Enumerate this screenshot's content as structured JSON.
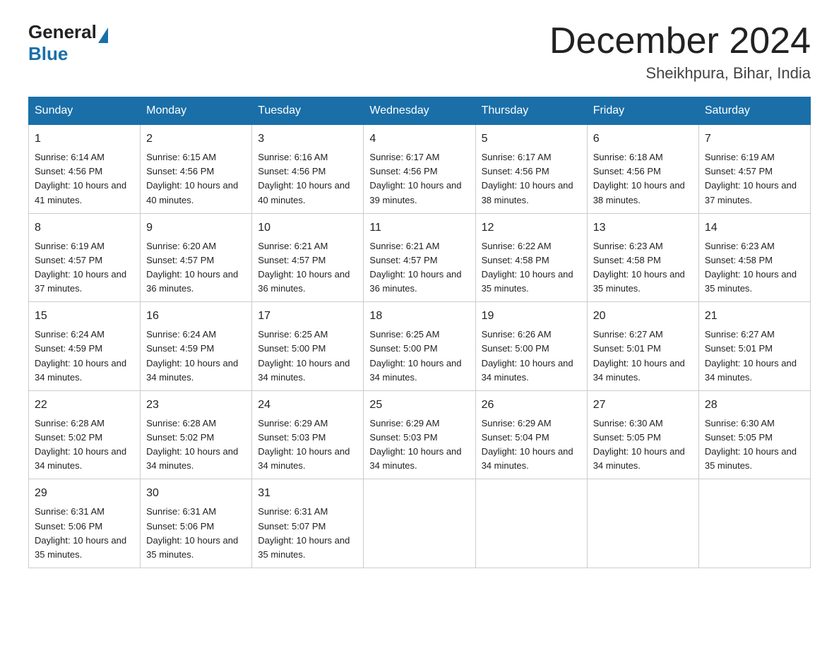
{
  "header": {
    "logo_general": "General",
    "logo_blue": "Blue",
    "month_title": "December 2024",
    "location": "Sheikhpura, Bihar, India"
  },
  "days_of_week": [
    "Sunday",
    "Monday",
    "Tuesday",
    "Wednesday",
    "Thursday",
    "Friday",
    "Saturday"
  ],
  "weeks": [
    [
      {
        "day": "1",
        "sunrise": "6:14 AM",
        "sunset": "4:56 PM",
        "daylight": "10 hours and 41 minutes."
      },
      {
        "day": "2",
        "sunrise": "6:15 AM",
        "sunset": "4:56 PM",
        "daylight": "10 hours and 40 minutes."
      },
      {
        "day": "3",
        "sunrise": "6:16 AM",
        "sunset": "4:56 PM",
        "daylight": "10 hours and 40 minutes."
      },
      {
        "day": "4",
        "sunrise": "6:17 AM",
        "sunset": "4:56 PM",
        "daylight": "10 hours and 39 minutes."
      },
      {
        "day": "5",
        "sunrise": "6:17 AM",
        "sunset": "4:56 PM",
        "daylight": "10 hours and 38 minutes."
      },
      {
        "day": "6",
        "sunrise": "6:18 AM",
        "sunset": "4:56 PM",
        "daylight": "10 hours and 38 minutes."
      },
      {
        "day": "7",
        "sunrise": "6:19 AM",
        "sunset": "4:57 PM",
        "daylight": "10 hours and 37 minutes."
      }
    ],
    [
      {
        "day": "8",
        "sunrise": "6:19 AM",
        "sunset": "4:57 PM",
        "daylight": "10 hours and 37 minutes."
      },
      {
        "day": "9",
        "sunrise": "6:20 AM",
        "sunset": "4:57 PM",
        "daylight": "10 hours and 36 minutes."
      },
      {
        "day": "10",
        "sunrise": "6:21 AM",
        "sunset": "4:57 PM",
        "daylight": "10 hours and 36 minutes."
      },
      {
        "day": "11",
        "sunrise": "6:21 AM",
        "sunset": "4:57 PM",
        "daylight": "10 hours and 36 minutes."
      },
      {
        "day": "12",
        "sunrise": "6:22 AM",
        "sunset": "4:58 PM",
        "daylight": "10 hours and 35 minutes."
      },
      {
        "day": "13",
        "sunrise": "6:23 AM",
        "sunset": "4:58 PM",
        "daylight": "10 hours and 35 minutes."
      },
      {
        "day": "14",
        "sunrise": "6:23 AM",
        "sunset": "4:58 PM",
        "daylight": "10 hours and 35 minutes."
      }
    ],
    [
      {
        "day": "15",
        "sunrise": "6:24 AM",
        "sunset": "4:59 PM",
        "daylight": "10 hours and 34 minutes."
      },
      {
        "day": "16",
        "sunrise": "6:24 AM",
        "sunset": "4:59 PM",
        "daylight": "10 hours and 34 minutes."
      },
      {
        "day": "17",
        "sunrise": "6:25 AM",
        "sunset": "5:00 PM",
        "daylight": "10 hours and 34 minutes."
      },
      {
        "day": "18",
        "sunrise": "6:25 AM",
        "sunset": "5:00 PM",
        "daylight": "10 hours and 34 minutes."
      },
      {
        "day": "19",
        "sunrise": "6:26 AM",
        "sunset": "5:00 PM",
        "daylight": "10 hours and 34 minutes."
      },
      {
        "day": "20",
        "sunrise": "6:27 AM",
        "sunset": "5:01 PM",
        "daylight": "10 hours and 34 minutes."
      },
      {
        "day": "21",
        "sunrise": "6:27 AM",
        "sunset": "5:01 PM",
        "daylight": "10 hours and 34 minutes."
      }
    ],
    [
      {
        "day": "22",
        "sunrise": "6:28 AM",
        "sunset": "5:02 PM",
        "daylight": "10 hours and 34 minutes."
      },
      {
        "day": "23",
        "sunrise": "6:28 AM",
        "sunset": "5:02 PM",
        "daylight": "10 hours and 34 minutes."
      },
      {
        "day": "24",
        "sunrise": "6:29 AM",
        "sunset": "5:03 PM",
        "daylight": "10 hours and 34 minutes."
      },
      {
        "day": "25",
        "sunrise": "6:29 AM",
        "sunset": "5:03 PM",
        "daylight": "10 hours and 34 minutes."
      },
      {
        "day": "26",
        "sunrise": "6:29 AM",
        "sunset": "5:04 PM",
        "daylight": "10 hours and 34 minutes."
      },
      {
        "day": "27",
        "sunrise": "6:30 AM",
        "sunset": "5:05 PM",
        "daylight": "10 hours and 34 minutes."
      },
      {
        "day": "28",
        "sunrise": "6:30 AM",
        "sunset": "5:05 PM",
        "daylight": "10 hours and 35 minutes."
      }
    ],
    [
      {
        "day": "29",
        "sunrise": "6:31 AM",
        "sunset": "5:06 PM",
        "daylight": "10 hours and 35 minutes."
      },
      {
        "day": "30",
        "sunrise": "6:31 AM",
        "sunset": "5:06 PM",
        "daylight": "10 hours and 35 minutes."
      },
      {
        "day": "31",
        "sunrise": "6:31 AM",
        "sunset": "5:07 PM",
        "daylight": "10 hours and 35 minutes."
      },
      null,
      null,
      null,
      null
    ]
  ]
}
